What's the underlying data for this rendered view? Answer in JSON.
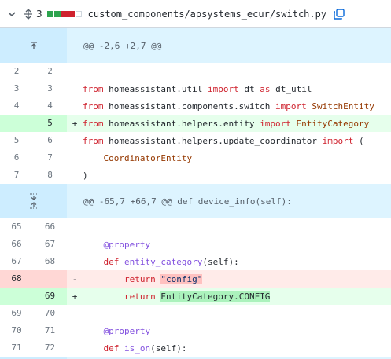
{
  "header": {
    "changes_count": "3",
    "file_path": "custom_components/apsystems_ecur/switch.py",
    "diffstat_colors": [
      "#2da44e",
      "#2da44e",
      "#cf222e",
      "#cf222e",
      "#d0d7de"
    ]
  },
  "hunks": [
    {
      "label": "@@ -2,6 +2,7 @@"
    },
    {
      "label": "@@ -65,7 +66,7 @@ def device_info(self):"
    }
  ],
  "lines": [
    {
      "old": "2",
      "new": "2",
      "sign": "",
      "code": ""
    },
    {
      "old": "3",
      "new": "3",
      "sign": "",
      "parts": [
        [
          "kw",
          "from"
        ],
        [
          "",
          " homeassistant.util "
        ],
        [
          "kw",
          "import"
        ],
        [
          "",
          " dt "
        ],
        [
          "kw",
          "as"
        ],
        [
          "",
          " dt_util"
        ]
      ]
    },
    {
      "old": "4",
      "new": "4",
      "sign": "",
      "parts": [
        [
          "kw",
          "from"
        ],
        [
          "",
          " homeassistant.components.switch "
        ],
        [
          "kw",
          "import"
        ],
        [
          "cls",
          " SwitchEntity"
        ]
      ]
    },
    {
      "old": "",
      "new": "5",
      "sign": "+",
      "parts": [
        [
          "kw",
          "from"
        ],
        [
          "",
          " homeassistant.helpers.entity "
        ],
        [
          "kw",
          "import"
        ],
        [
          "cls",
          " EntityCategory"
        ]
      ]
    },
    {
      "old": "5",
      "new": "6",
      "sign": "",
      "parts": [
        [
          "kw",
          "from"
        ],
        [
          "",
          " homeassistant.helpers.update_coordinator "
        ],
        [
          "kw",
          "import"
        ],
        [
          "",
          " ("
        ]
      ]
    },
    {
      "old": "6",
      "new": "7",
      "sign": "",
      "parts": [
        [
          "",
          "    "
        ],
        [
          "cls",
          "CoordinatorEntity"
        ]
      ]
    },
    {
      "old": "7",
      "new": "8",
      "sign": "",
      "parts": [
        [
          "",
          ")"
        ]
      ]
    },
    {
      "old": "65",
      "new": "66",
      "sign": "",
      "code": ""
    },
    {
      "old": "66",
      "new": "67",
      "sign": "",
      "parts": [
        [
          "",
          "    "
        ],
        [
          "deco",
          "@property"
        ]
      ]
    },
    {
      "old": "67",
      "new": "68",
      "sign": "",
      "parts": [
        [
          "",
          "    "
        ],
        [
          "kw",
          "def"
        ],
        [
          "fn",
          " entity_category"
        ],
        [
          "",
          "(self):"
        ]
      ]
    },
    {
      "old": "68",
      "new": "",
      "sign": "-",
      "parts": [
        [
          "",
          "        "
        ],
        [
          "kw",
          "return"
        ],
        [
          "",
          " "
        ],
        [
          "hl-str",
          "\"config\""
        ]
      ]
    },
    {
      "old": "",
      "new": "69",
      "sign": "+",
      "parts": [
        [
          "",
          "        "
        ],
        [
          "kw",
          "return"
        ],
        [
          "",
          " "
        ],
        [
          "hl",
          "EntityCategory.CONFIG"
        ]
      ]
    },
    {
      "old": "69",
      "new": "70",
      "sign": "",
      "code": ""
    },
    {
      "old": "70",
      "new": "71",
      "sign": "",
      "parts": [
        [
          "",
          "    "
        ],
        [
          "deco",
          "@property"
        ]
      ]
    },
    {
      "old": "71",
      "new": "72",
      "sign": "",
      "parts": [
        [
          "",
          "    "
        ],
        [
          "kw",
          "def"
        ],
        [
          "fn",
          " is_on"
        ],
        [
          "",
          "(self):"
        ]
      ]
    }
  ]
}
